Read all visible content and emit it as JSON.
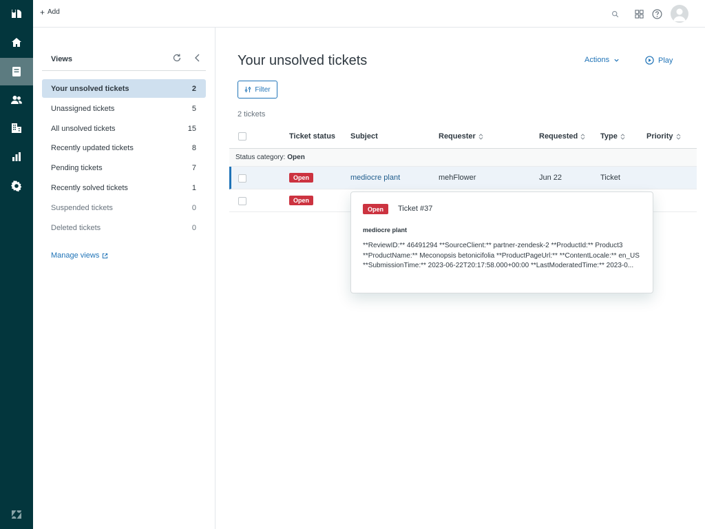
{
  "topbar": {
    "add_label": "Add"
  },
  "views": {
    "title": "Views",
    "items": [
      {
        "label": "Your unsolved tickets",
        "count": "2"
      },
      {
        "label": "Unassigned tickets",
        "count": "5"
      },
      {
        "label": "All unsolved tickets",
        "count": "15"
      },
      {
        "label": "Recently updated tickets",
        "count": "8"
      },
      {
        "label": "Pending tickets",
        "count": "7"
      },
      {
        "label": "Recently solved tickets",
        "count": "1"
      },
      {
        "label": "Suspended tickets",
        "count": "0"
      },
      {
        "label": "Deleted tickets",
        "count": "0"
      }
    ],
    "manage_label": "Manage views"
  },
  "main": {
    "title": "Your unsolved tickets",
    "actions_label": "Actions",
    "play_label": "Play",
    "filter_label": "Filter",
    "ticket_count": "2 tickets",
    "columns": {
      "status": "Ticket status",
      "subject": "Subject",
      "requester": "Requester",
      "requested": "Requested",
      "type": "Type",
      "priority": "Priority"
    },
    "group": {
      "label": "Status category:",
      "value": "Open"
    },
    "rows": [
      {
        "status": "Open",
        "subject": "mediocre plant",
        "requester": "mehFlower",
        "requested": "Jun 22",
        "type": "Ticket",
        "priority": ""
      },
      {
        "status": "Open",
        "subject": "",
        "requester": "",
        "requested": "",
        "type": "",
        "priority": ""
      }
    ]
  },
  "popover": {
    "status": "Open",
    "ticket_number": "Ticket #37",
    "subject": "mediocre plant",
    "description": "**ReviewID:** 46491294 **SourceClient:** partner-zendesk-2 **ProductId:** Product3 **ProductName:** Meconopsis betonicifolia **ProductPageUrl:** **ContentLocale:** en_US **SubmissionTime:** 2023-06-22T20:17:58.000+00:00 **LastModeratedTime:** 2023-0..."
  },
  "colors": {
    "rail": "#03363d",
    "accent": "#1f73b7",
    "open_badge": "#cc3340",
    "active_view": "#cfe0ef"
  }
}
